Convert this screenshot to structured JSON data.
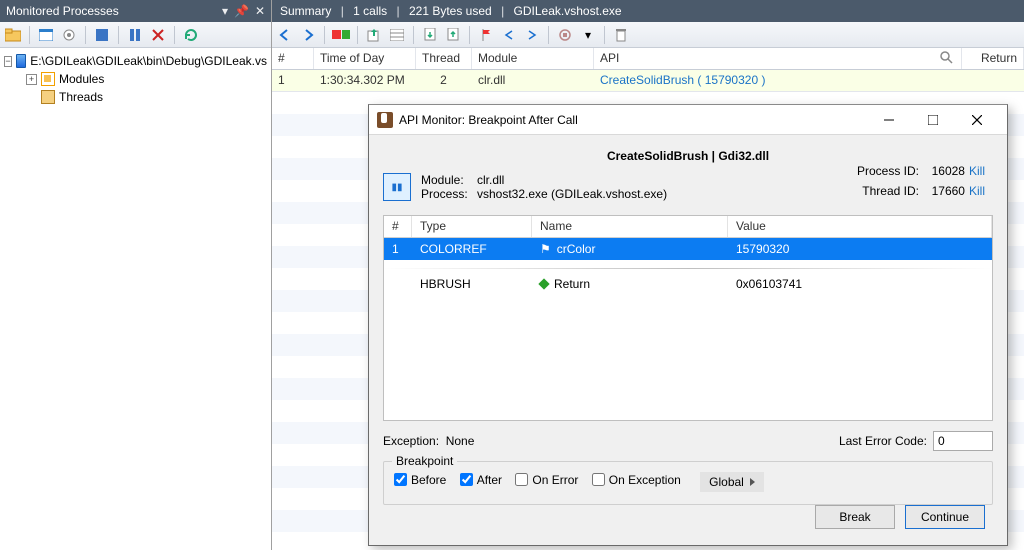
{
  "leftPanel": {
    "title": "Monitored Processes",
    "tree": {
      "root": "E:\\GDILeak\\GDILeak\\bin\\Debug\\GDILeak.vs",
      "child1": "Modules",
      "child2": "Threads"
    }
  },
  "summary": {
    "label": "Summary",
    "calls": "1 calls",
    "bytes": "221 Bytes used",
    "proc": "GDILeak.vshost.exe"
  },
  "columns": {
    "c1": "#",
    "c2": "Time of Day",
    "c3": "Thread",
    "c4": "Module",
    "c5": "API",
    "c6": "Return"
  },
  "row1": {
    "c1": "1",
    "c2": "1:30:34.302 PM",
    "c3": "2",
    "c4": "clr.dll",
    "api_name": "CreateSolidBrush",
    "api_arg": "( 15790320 )"
  },
  "dialog": {
    "title": "API Monitor: Breakpoint After Call",
    "heading": "CreateSolidBrush | Gdi32.dll",
    "module_label": "Module:",
    "module_value": "clr.dll",
    "process_label": "Process:",
    "process_value": "vshost32.exe (GDILeak.vshost.exe)",
    "procid_label": "Process ID:",
    "procid_value": "16028",
    "threadid_label": "Thread ID:",
    "threadid_value": "17660",
    "kill": "Kill",
    "pt": {
      "h1": "#",
      "h2": "Type",
      "h3": "Name",
      "h4": "Value"
    },
    "param1": {
      "n": "1",
      "type": "COLORREF",
      "name": "crColor",
      "value": "15790320"
    },
    "return": {
      "type": "HBRUSH",
      "name": "Return",
      "value": "0x06103741"
    },
    "exception_label": "Exception:",
    "exception_value": "None",
    "lasterr_label": "Last Error Code:",
    "lasterr_value": "0",
    "bp_legend": "Breakpoint",
    "cb_before": "Before",
    "cb_after": "After",
    "cb_onerror": "On Error",
    "cb_onexc": "On Exception",
    "global": "Global",
    "break": "Break",
    "continue": "Continue"
  }
}
